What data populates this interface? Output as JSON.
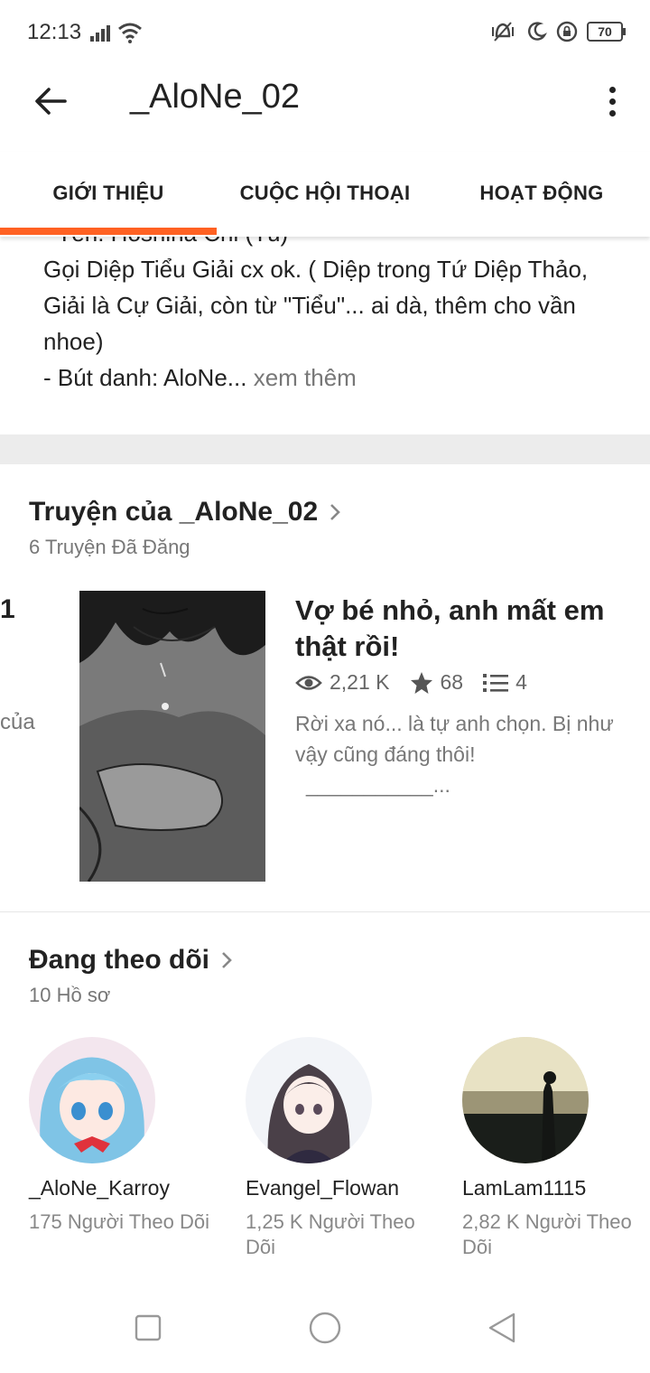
{
  "status_bar": {
    "time": "12:13",
    "battery": "70",
    "icons": [
      "signal-icon",
      "wifi-icon",
      "vibrate-icon",
      "moon-icon",
      "lock-rotation-icon",
      "battery-icon"
    ]
  },
  "app_bar": {
    "title": "_AloNe_02"
  },
  "tabs": [
    {
      "label": "GIỚI THIỆU",
      "active": true
    },
    {
      "label": "CUỘC HỘI THOẠI",
      "active": false
    },
    {
      "label": "HOẠT ĐỘNG",
      "active": false
    }
  ],
  "about": {
    "partial_line": "- Tên: Hoshina Chi (Tú)",
    "line1": "Gọi Diệp Tiểu Giải cx ok. ( Diệp trong Tứ Diệp Thảo, Giải là Cự Giải, còn từ \"Tiểu\"... ai dà, thêm cho vần nhoe)",
    "line2": "- Bút danh: AloNe...",
    "more_link": " xem thêm"
  },
  "stories": {
    "title": "Truyện của _AloNe_02",
    "subtitle": "6 Truyện Đã Đăng",
    "partial_prev_number": "1",
    "partial_prev_word": "của",
    "items": [
      {
        "title": "Vợ bé nhỏ, anh mất em thật rồi!",
        "views": "2,21 K",
        "votes": "68",
        "parts": "4",
        "description": "Rời xa nó... là tự anh chọn. Bị như vậy cũng đáng thôi!",
        "description_tail": "___________..."
      }
    ]
  },
  "following": {
    "title": "Đang theo dõi",
    "subtitle": "10 Hồ sơ",
    "profiles": [
      {
        "name": "_AloNe_Karroy",
        "followers": "175 Người Theo Dõi"
      },
      {
        "name": "Evangel_Flowan",
        "followers": "1,25 K Người Theo Dõi"
      },
      {
        "name": "LamLam1115",
        "followers": "2,82 K Người Theo Dõi"
      }
    ]
  },
  "colors": {
    "accent": "#ff6122",
    "text": "#222222",
    "muted": "#777777",
    "divider": "#ececec"
  }
}
